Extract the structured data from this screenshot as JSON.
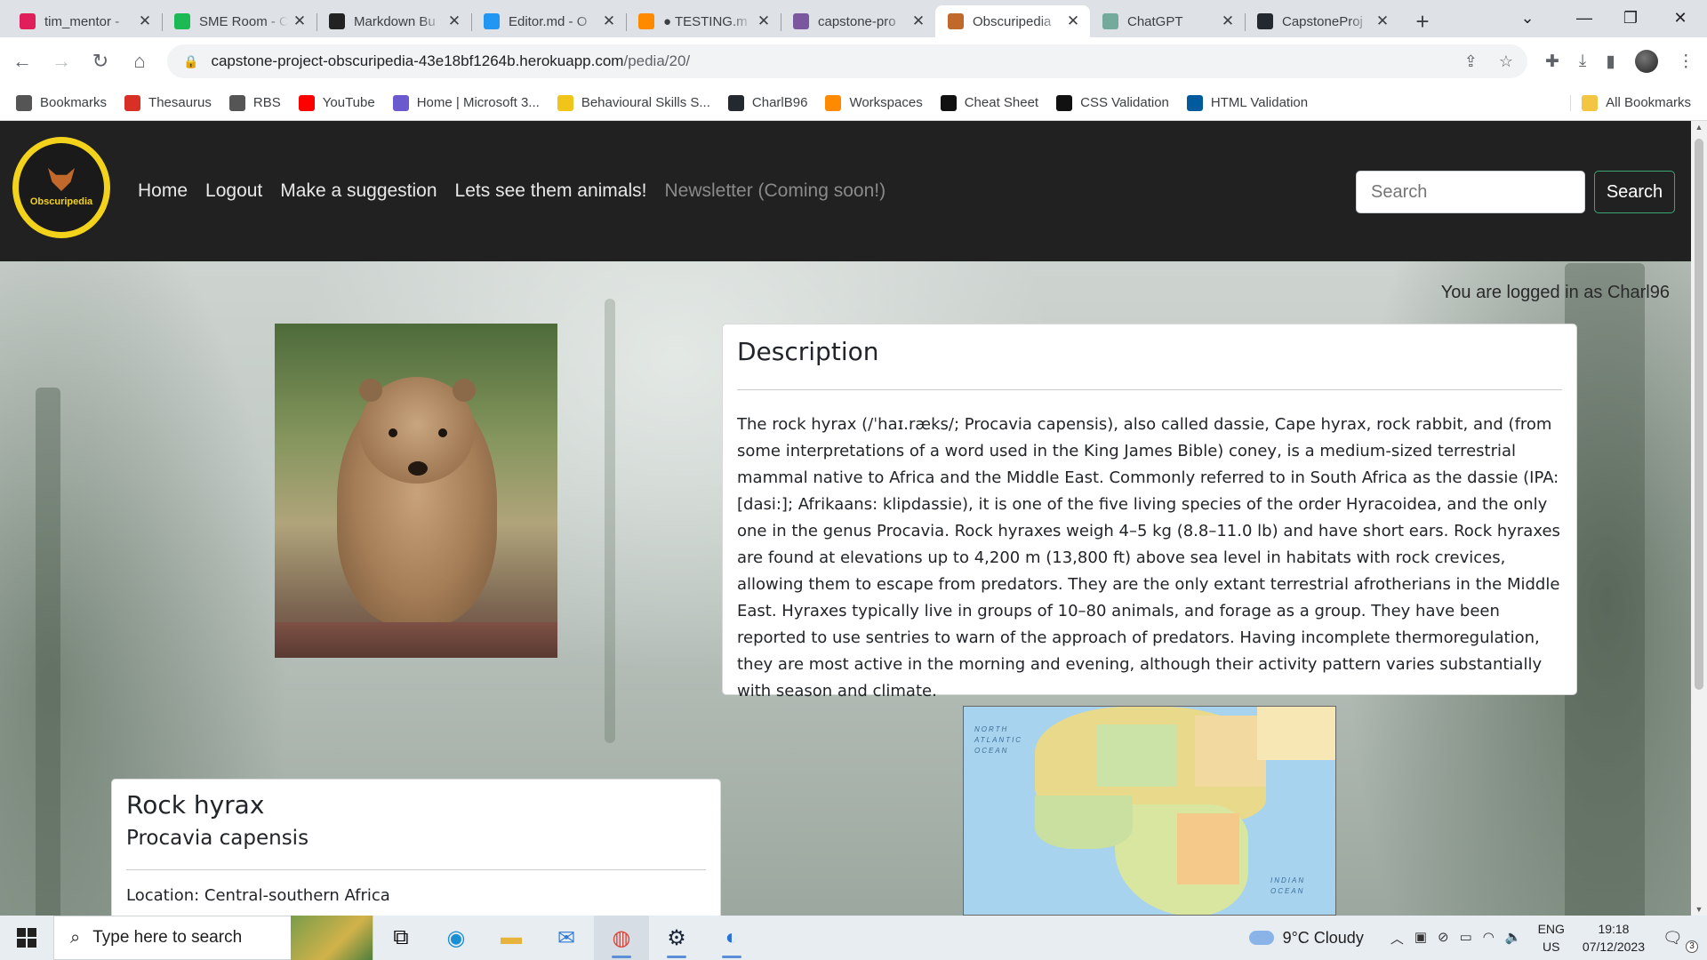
{
  "browser": {
    "tabs": [
      {
        "label": "tim_mentor -",
        "icon": "slack-icon",
        "color": "#e01e5a",
        "active": false
      },
      {
        "label": "SME Room - C",
        "icon": "green-circle-icon",
        "color": "#1db954",
        "active": false
      },
      {
        "label": "Markdown Bu",
        "icon": "markdown-icon",
        "color": "#222222",
        "active": false
      },
      {
        "label": "Editor.md - O",
        "icon": "editor-md-icon",
        "color": "#2196f3",
        "active": false
      },
      {
        "label": "● TESTING.m",
        "icon": "gitpod-icon",
        "color": "#ff8a00",
        "active": false
      },
      {
        "label": "capstone-pro",
        "icon": "heroku-icon",
        "color": "#79589f",
        "active": false
      },
      {
        "label": "Obscuripedia",
        "icon": "fox-icon",
        "color": "#c0692a",
        "active": true
      },
      {
        "label": "ChatGPT",
        "icon": "chatgpt-icon",
        "color": "#74aa9c",
        "active": false
      },
      {
        "label": "CapstoneProj",
        "icon": "github-icon",
        "color": "#24292f",
        "active": false
      }
    ],
    "url_host": "capstone-project-obscuripedia-43e18bf1264b.herokuapp.com",
    "url_path": "/pedia/20/",
    "bookmarks": [
      {
        "label": "Bookmarks",
        "icon": "star-icon",
        "color": "#555555"
      },
      {
        "label": "Thesaurus",
        "icon": "thesaurus-icon",
        "color": "#d93025"
      },
      {
        "label": "RBS",
        "icon": "rbs-icon",
        "color": "#555555"
      },
      {
        "label": "YouTube",
        "icon": "youtube-icon",
        "color": "#ff0000"
      },
      {
        "label": "Home | Microsoft 3...",
        "icon": "microsoft-icon",
        "color": "#6a5acd"
      },
      {
        "label": "Behavioural Skills S...",
        "icon": "miro-icon",
        "color": "#f0c419"
      },
      {
        "label": "CharlB96",
        "icon": "github-icon",
        "color": "#24292f"
      },
      {
        "label": "Workspaces",
        "icon": "gitpod-icon",
        "color": "#ff8a00"
      },
      {
        "label": "Cheat Sheet",
        "icon": "cheat-sheet-icon",
        "color": "#111111"
      },
      {
        "label": "CSS Validation",
        "icon": "css-icon",
        "color": "#111111"
      },
      {
        "label": "HTML Validation",
        "icon": "w3c-icon",
        "color": "#005a9c"
      }
    ],
    "all_bookmarks": "All Bookmarks"
  },
  "site": {
    "logo_text": "Obscuripedia",
    "nav": [
      "Home",
      "Logout",
      "Make a suggestion",
      "Lets see them animals!",
      "Newsletter (Coming soon!)"
    ],
    "search_placeholder": "Search",
    "search_button": "Search",
    "logged_in": "You are logged in as Charl96"
  },
  "animal": {
    "name": "Rock hyrax",
    "scientific": "Procavia capensis",
    "location": "Location: Central-southern Africa",
    "description_title": "Description",
    "description": "The rock hyrax (/ˈhaɪ.ræks/; Procavia capensis), also called dassie, Cape hyrax, rock rabbit, and (from some interpretations of a word used in the King James Bible) coney, is a medium-sized terrestrial mammal native to Africa and the Middle East. Commonly referred to in South Africa as the dassie (IPA: [dasi:]; Afrikaans: klipdassie), it is one of the five living species of the order Hyracoidea, and the only one in the genus Procavia. Rock hyraxes weigh 4–5 kg (8.8–11.0 lb) and have short ears. Rock hyraxes are found at elevations up to 4,200 m (13,800 ft) above sea level in habitats with rock crevices, allowing them to escape from predators. They are the only extant terrestrial afrotherians in the Middle East. Hyraxes typically live in groups of 10–80 animals, and forage as a group. They have been reported to use sentries to warn of the approach of predators. Having incomplete thermoregulation, they are most active in the morning and evening, although their activity pattern varies substantially with season and climate.",
    "map_labels": {
      "north_atlantic": "NORTH ATLANTIC OCEAN",
      "indian": "INDIAN OCEAN"
    }
  },
  "taskbar": {
    "search_placeholder": "Type here to search",
    "weather": "9°C  Cloudy",
    "lang_top": "ENG",
    "lang_bottom": "US",
    "time": "19:18",
    "date": "07/12/2023",
    "notifications": "3"
  }
}
